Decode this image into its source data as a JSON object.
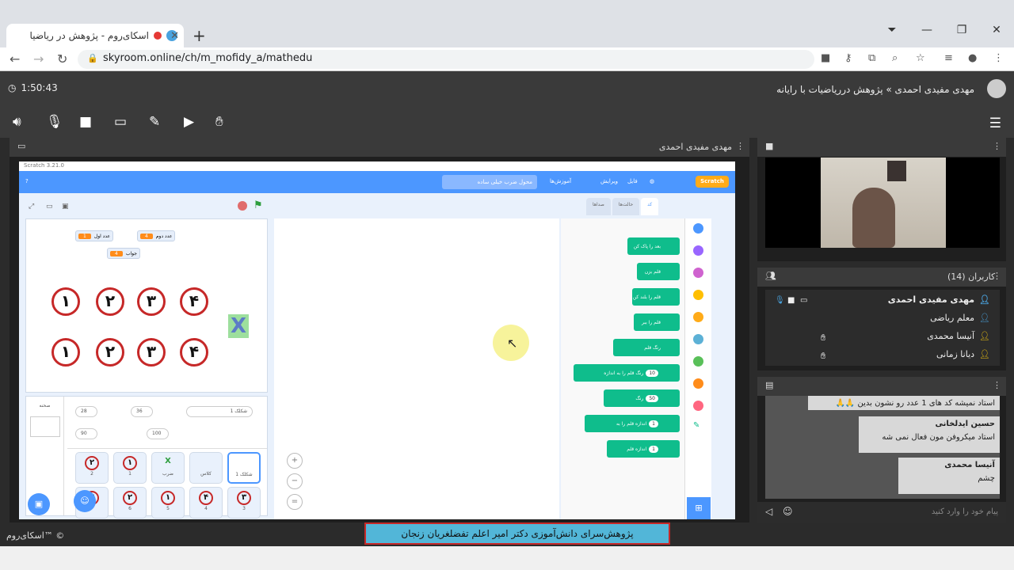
{
  "browser": {
    "tab_title": "اسکای‌روم - پژوهش در ریاضیا",
    "url": "skyroom.online/ch/m_mofidy_a/mathedu"
  },
  "app": {
    "timer": "1:50:43",
    "breadcrumb": "مهدی مفیدی احمدی » پژوهش درریاضیات با رایانه",
    "presenter": "مهدی مفیدی احمدی",
    "brand": "اسکای‌روم™ ©"
  },
  "scratch": {
    "window_title": "Scratch 3.21.0",
    "menu": [
      "آموزش‌ها",
      "ویرایش",
      "فایل"
    ],
    "project_title": "محول ضرب خیلی ساده",
    "tabs": [
      "کد",
      "حالت‌ها",
      "صداها"
    ],
    "variables": [
      {
        "label": "عدد دوم",
        "value": "4"
      },
      {
        "label": "عدد اول",
        "value": "1"
      },
      {
        "label": "جواب",
        "value": "4"
      }
    ],
    "row1": [
      "۱",
      "۲",
      "۳",
      "۴"
    ],
    "row2": [
      "۱",
      "۲",
      "۳",
      "۴"
    ],
    "x_mark": "X",
    "blocks": [
      {
        "text": "بعد را پاک کن",
        "val": ""
      },
      {
        "text": "قلم بزن",
        "val": ""
      },
      {
        "text": "قلم را بلند کن",
        "val": ""
      },
      {
        "text": "قلم را ببر",
        "val": ""
      },
      {
        "text": "رنگ قلم",
        "val": ""
      },
      {
        "text": "رنگ قلم را به اندازه",
        "val": "10"
      },
      {
        "text": "رنگ",
        "val": "50"
      },
      {
        "text": "اندازه قلم را به",
        "val": "1"
      },
      {
        "text": "اندازه قلم",
        "val": "1"
      }
    ],
    "sprite_fields": {
      "name": "شکلک 1",
      "x": "36",
      "y": "28",
      "size": "100",
      "direction": "90"
    },
    "sprites": [
      {
        "glyph": "۲",
        "label": "2"
      },
      {
        "glyph": "۱",
        "label": "1"
      },
      {
        "glyph": "X",
        "label": "ضرب"
      },
      {
        "glyph": "",
        "label": "کلاس"
      },
      {
        "glyph": "",
        "label": "شکلک 1"
      },
      {
        "glyph": "۳",
        "label": ""
      },
      {
        "glyph": "۲",
        "label": "6"
      },
      {
        "glyph": "۱",
        "label": "5"
      },
      {
        "glyph": "۴",
        "label": "4"
      },
      {
        "glyph": "۳",
        "label": "3"
      }
    ],
    "stage_label": "صحنه"
  },
  "users": {
    "title": "کاربران (14)",
    "list": [
      {
        "name": "مهدی مفیدی احمدی",
        "bold": true
      },
      {
        "name": "معلم ریاضی",
        "bold": false
      },
      {
        "name": "آنیسا محمدی",
        "bold": false
      },
      {
        "name": "دیانا زمانی",
        "bold": false
      }
    ]
  },
  "chat": {
    "messages": [
      {
        "author": "",
        "text": "استاد نمیشه کد های 1 عدد رو نشون بدین 🙏🙏"
      },
      {
        "author": "حسین ایدلخانی",
        "text": "استاد میکروفن مون فعال نمی شه"
      },
      {
        "author": "آنیسا محمدی",
        "text": "چشم"
      }
    ],
    "placeholder": "پیام خود را وارد کنید"
  },
  "banner": "پژوهش‌سرای دانش‌آموزی دکتر امیر اعلم تفضلغریان زنجان"
}
